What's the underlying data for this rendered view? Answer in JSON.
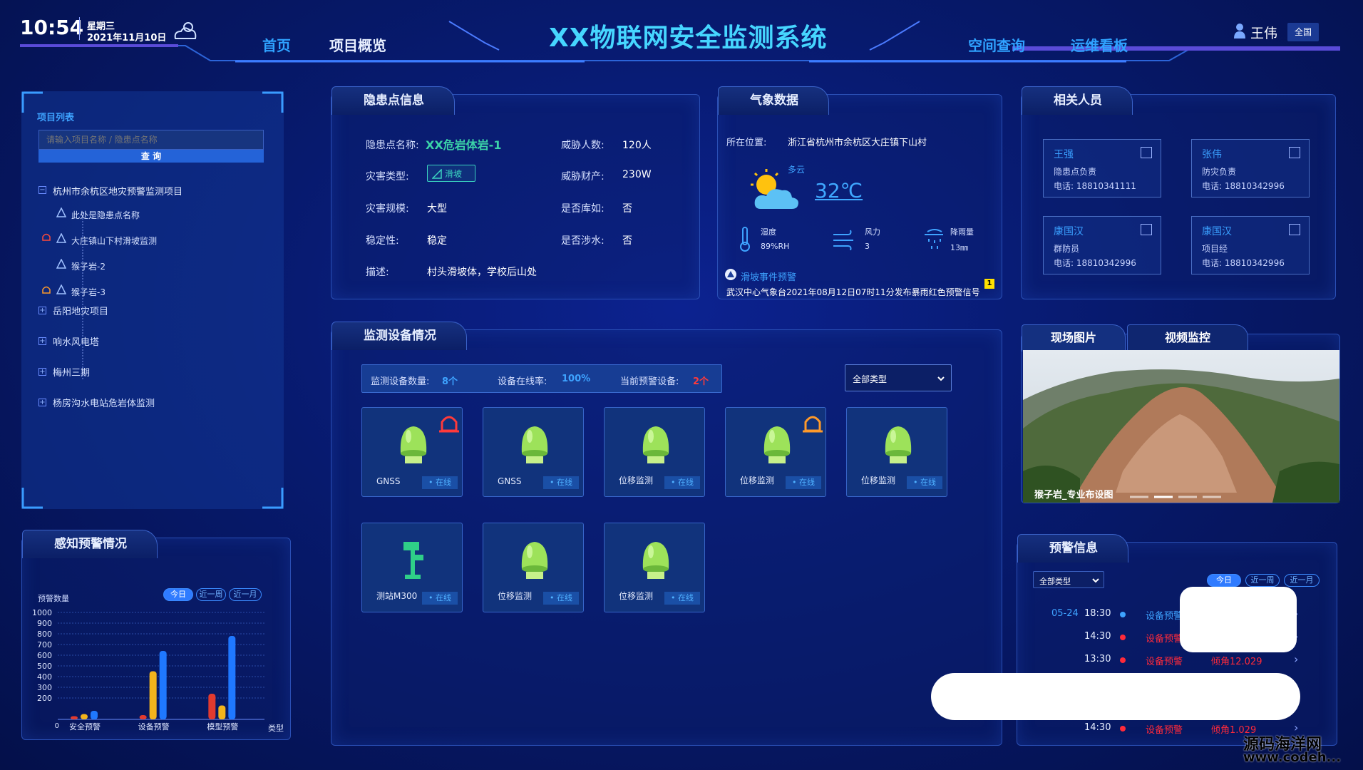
{
  "header": {
    "time": "10:54",
    "weekday": "星期三",
    "date": "2021年11月10日",
    "title": "XX物联网安全监测系统",
    "nav_left": [
      "首页",
      "项目概览"
    ],
    "nav_right": [
      "空间查询",
      "运维看板"
    ],
    "user": "王伟",
    "scope": "全国"
  },
  "project_list": {
    "title": "项目列表",
    "search_placeholder": "请输入项目名称 / 隐患点名称",
    "search_button": "查 询",
    "root": "杭州市余杭区地灾预警监测项目",
    "children": [
      "此处是隐患点名称",
      "大庄镇山下村滑坡监测",
      "猴子岩-2",
      "猴子岩-3"
    ],
    "others": [
      "岳阳地灾项目",
      "响水风电塔",
      "梅州三期",
      "杨房沟水电站危岩体监测"
    ]
  },
  "hazard": {
    "title": "隐患点信息",
    "name_label": "隐患点名称:",
    "name": "XX危岩体岩-1",
    "threat_people_label": "威胁人数:",
    "threat_people": "120人",
    "type_label": "灾害类型:",
    "type": "滑坡",
    "threat_prop_label": "威胁财产:",
    "threat_prop": "230W",
    "scale_label": "灾害规模:",
    "scale": "大型",
    "db_label": "是否库如:",
    "db": "否",
    "stab_label": "稳定性:",
    "stab": "稳定",
    "water_label": "是否涉水:",
    "water": "否",
    "desc_label": "描述:",
    "desc": "村头滑坡体，学校后山处"
  },
  "weather": {
    "title": "气象数据",
    "loc_label": "所在位置:",
    "loc": "浙江省杭州市余杭区大庄镇下山村",
    "cond": "多云",
    "temp": "32℃",
    "hum_label": "湿度",
    "hum": "89%RH",
    "wind_label": "风力",
    "wind": "3",
    "rain_label": "降雨量",
    "rain": "13㎜",
    "alert_title": "滑坡事件预警",
    "alert_text": "武汉中心气象台2021年08月12日07时11分发布暴雨红色预警信号",
    "alert_badge": "1"
  },
  "people": {
    "title": "相关人员",
    "cards": [
      {
        "name": "王强",
        "role": "隐患点负责",
        "phone": "电话: 18810341111"
      },
      {
        "name": "张伟",
        "role": "防灾负责",
        "phone": "电话: 18810342996"
      },
      {
        "name": "康国汉",
        "role": "群防员",
        "phone": "电话: 18810342996"
      },
      {
        "name": "康国汉",
        "role": "项目经",
        "phone": "电话: 18810342996"
      }
    ]
  },
  "devices": {
    "title": "监测设备情况",
    "count_label": "监测设备数量:",
    "count": "8个",
    "online_label": "设备在线率:",
    "online": "100%",
    "warn_label": "当前预警设备:",
    "warn": "2个",
    "filter": "全部类型",
    "items": [
      {
        "name": "GNSS",
        "status": "在线"
      },
      {
        "name": "GNSS",
        "status": "在线"
      },
      {
        "name": "位移监测",
        "status": "在线"
      },
      {
        "name": "位移监测",
        "status": "在线"
      },
      {
        "name": "位移监测",
        "status": "在线"
      },
      {
        "name": "测站M300",
        "status": "在线"
      },
      {
        "name": "位移监测",
        "status": "在线"
      },
      {
        "name": "位移监测",
        "status": "在线"
      }
    ]
  },
  "media": {
    "tabs": [
      "现场图片",
      "视频监控"
    ],
    "caption": "猴子岩_专业布设图"
  },
  "perception": {
    "title": "感知预警情况",
    "ylabel": "预警数量",
    "xlabel": "类型",
    "tabs": [
      "今日",
      "近一周",
      "近一月"
    ]
  },
  "chart_data": {
    "type": "bar",
    "categories": [
      "安全预警",
      "设备预警",
      "模型预警"
    ],
    "series": [
      {
        "values": [
          30,
          40,
          240
        ]
      },
      {
        "values": [
          50,
          450,
          130
        ]
      },
      {
        "values": [
          80,
          640,
          780
        ]
      }
    ],
    "ylim": [
      0,
      1000
    ],
    "yticks": [
      "1000",
      "900",
      "800",
      "700",
      "600",
      "500",
      "400",
      "300",
      "200",
      "0"
    ],
    "colors": [
      "#e23a2e",
      "#f2b41c",
      "#1f78ff"
    ]
  },
  "warnings": {
    "title": "预警信息",
    "filter": "全部类型",
    "tabs": [
      "今日",
      "近一周",
      "近一月"
    ],
    "rows": [
      {
        "date": "05-24",
        "time": "18:30",
        "type": "设备预警",
        "detail": ""
      },
      {
        "date": "",
        "time": "14:30",
        "type": "设备预警",
        "detail": ""
      },
      {
        "date": "",
        "time": "13:30",
        "type": "设备预警",
        "detail": "倾角12.029"
      },
      {
        "date": "",
        "time": "14:30",
        "type": "设备预警",
        "detail": "倾角1.029"
      }
    ]
  },
  "watermark": [
    "源码海洋网",
    "www.codeh..."
  ]
}
